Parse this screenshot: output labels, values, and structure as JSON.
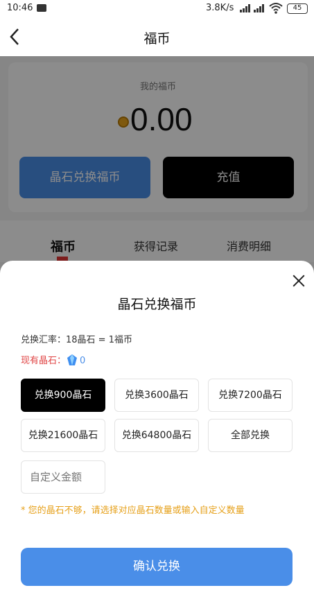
{
  "status_bar": {
    "time": "10:46",
    "net_speed": "3.8K/s",
    "battery": "45",
    "message_icon": "message-icon",
    "signal_icon": "signal-icon",
    "wifi_icon": "wifi-icon"
  },
  "nav": {
    "title": "福币",
    "back_icon": "chevron-left-icon"
  },
  "wallet": {
    "label": "我的福币",
    "amount": "0.00",
    "coin_icon": "coin-icon",
    "exchange_button": "晶石兑换福币",
    "recharge_button": "充值"
  },
  "tabs": [
    {
      "label": "福币",
      "active": true
    },
    {
      "label": "获得记录",
      "active": false
    },
    {
      "label": "消费明细",
      "active": false
    }
  ],
  "sheet": {
    "title": "晶石兑换福币",
    "rate_text": "兑换汇率：18晶石 = 1福币",
    "have_label": "现有晶石：",
    "have_value": "0",
    "gem_icon": "crystal-icon",
    "options": [
      {
        "label": "兑换900晶石",
        "selected": true
      },
      {
        "label": "兑换3600晶石",
        "selected": false
      },
      {
        "label": "兑换7200晶石",
        "selected": false
      },
      {
        "label": "兑换21600晶石",
        "selected": false
      },
      {
        "label": "兑换64800晶石",
        "selected": false
      },
      {
        "label": "全部兑换",
        "selected": false
      }
    ],
    "custom_placeholder": "自定义金额",
    "warning": "* 您的晶石不够，请选择对应晶石数量或输入自定义数量",
    "confirm_button": "确认兑换"
  },
  "colors": {
    "accent_blue": "#4a8ee8",
    "warning_orange": "#e6a019",
    "tab_indicator_red": "#e23636"
  }
}
